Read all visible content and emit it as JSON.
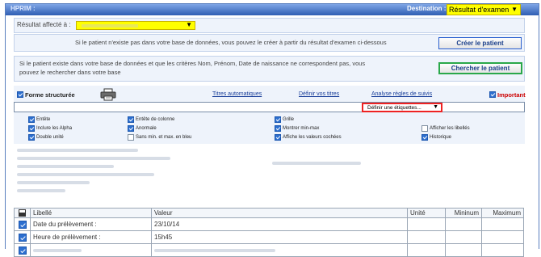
{
  "header": {
    "app_name": "HPRIM :",
    "destination_label": "Destination :",
    "destination_value": "Résultat d'examen"
  },
  "assignment": {
    "label": "Résultat affecté à :"
  },
  "create_patient": {
    "text": "Si le patient n'existe pas dans votre base de données, vous pouvez le créer à partir du résultat d'examen ci-dessous",
    "button": "Créer le patient"
  },
  "search_patient": {
    "text_line1": "Si le patient existe dans votre base de données et que les critères Nom, Prénom, Date de naissance ne correspondent pas, vous",
    "text_line2": "pouvez le rechercher dans votre base",
    "button": "Chercher le patient"
  },
  "toolbar": {
    "structured_form": "Forme structurée",
    "printer_icon": "printer-icon",
    "links": [
      "Titres automatiques",
      "Définir vos titres",
      "Analyse règles de suivis"
    ],
    "important": "Important",
    "labels_select": "Définir une étiquettes..."
  },
  "options": [
    {
      "label": "Entête",
      "checked": true
    },
    {
      "label": "Entête de colonne",
      "checked": true
    },
    {
      "label": "Grille",
      "checked": true
    },
    {
      "label": "Inclure les Alpha",
      "checked": true
    },
    {
      "label": "Anormale",
      "checked": true
    },
    {
      "label": "Montrer min-max",
      "checked": true
    },
    {
      "label": "Afficher les libellés",
      "checked": false
    },
    {
      "label": "Double unité",
      "checked": true
    },
    {
      "label": "Sans min. et max. en bleu",
      "checked": false
    },
    {
      "label": "Affiche les valeurs cochées",
      "checked": true
    },
    {
      "label": "Historique",
      "checked": true
    }
  ],
  "table": {
    "headers": [
      "Libellé",
      "Valeur",
      "Unité",
      "Mininum",
      "Maximum"
    ],
    "rows": [
      {
        "label": "Date du prélèvement :",
        "value": "23/10/14"
      },
      {
        "label": "Heure de prélèvement :",
        "value": "15h45"
      }
    ]
  },
  "colors": {
    "title_bar": "#2f5eb3",
    "highlight_yellow": "#ffff00",
    "search_border": "#2aa84a",
    "labels_border": "#ee2222",
    "important_red": "#cc0000"
  }
}
